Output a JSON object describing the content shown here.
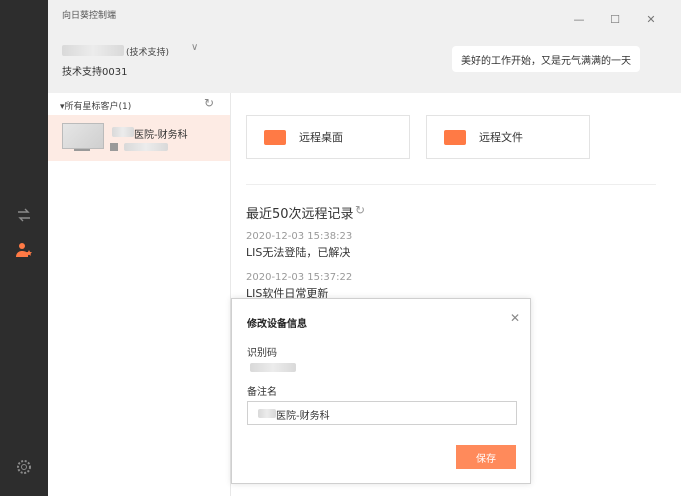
{
  "app": {
    "title": "向日葵控制端"
  },
  "account": {
    "name_suffix": "(技术支持)",
    "id_label": "技术支持0031"
  },
  "banner": {
    "text": "美好的工作开始，又是元气满满的一天"
  },
  "sidebar": {
    "group_label": "▾所有星标客户(1)",
    "device": {
      "name": "医院-财务科"
    }
  },
  "actions": {
    "remote_desktop": "远程桌面",
    "remote_file": "远程文件"
  },
  "records": {
    "title": "最近50次远程记录",
    "items": [
      {
        "time": "2020-12-03 15:38:23",
        "text": "LIS无法登陆，已解决"
      },
      {
        "time": "2020-12-03 15:37:22",
        "text": "LIS软件日常更新"
      }
    ]
  },
  "dialog": {
    "title": "修改设备信息",
    "id_label": "识别码",
    "remark_label": "备注名",
    "remark_value": "医院-财务科",
    "save_label": "保存"
  },
  "colors": {
    "accent": "#ff7a45",
    "rail": "#2d2d2d",
    "selected_row": "#fdebe4"
  }
}
